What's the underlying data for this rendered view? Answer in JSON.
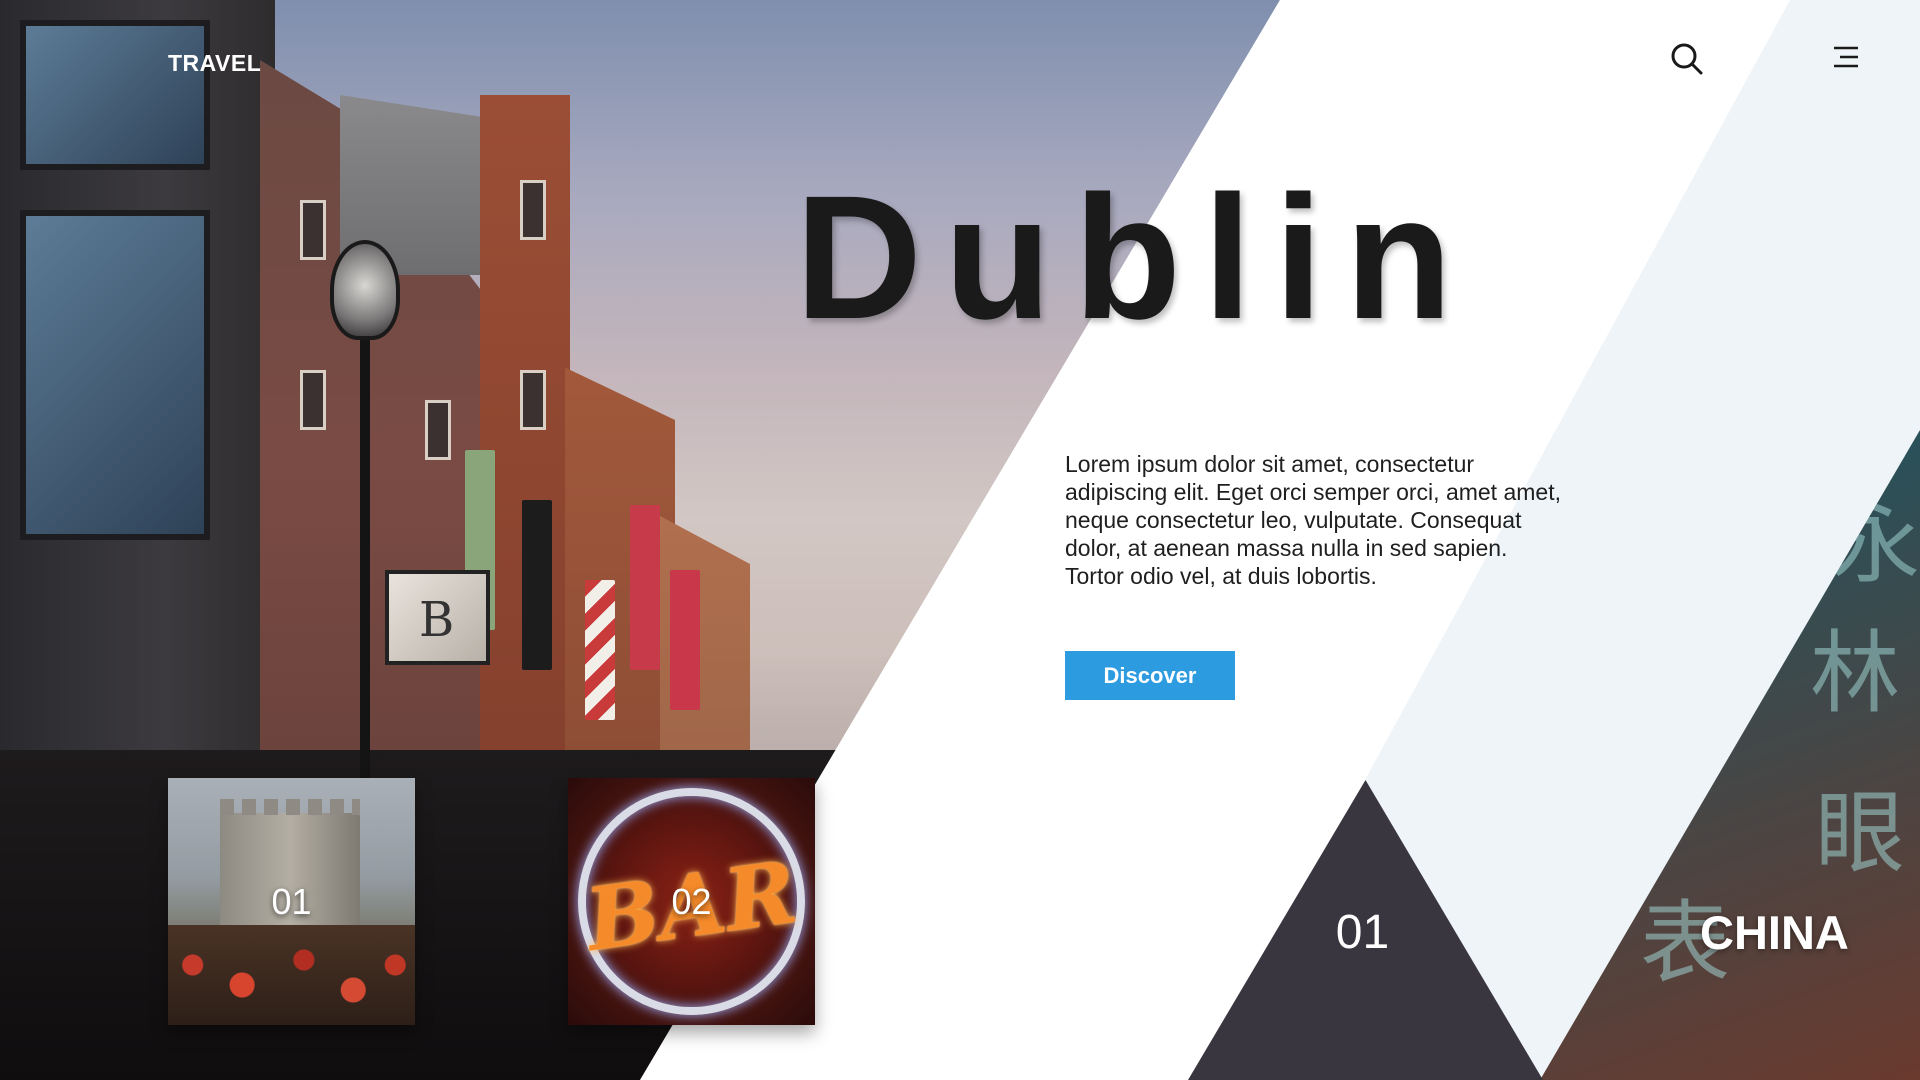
{
  "header": {
    "brand": "TRAVEL",
    "search_icon": "search-icon",
    "menu_icon": "menu-icon"
  },
  "hero": {
    "title": "Dublin",
    "description": "Lorem ipsum dolor sit amet, consectetur adipiscing elit. Eget orci semper orci, amet amet, neque consectetur leo, vulputate. Consequat dolor, at aenean massa nulla in sed sapien. Tortor odio vel, at duis lobortis.",
    "cta_label": "Discover"
  },
  "thumbnails": [
    {
      "number": "01"
    },
    {
      "number": "02"
    }
  ],
  "slider": {
    "current": "01",
    "next_destination": "CHINA"
  },
  "colors": {
    "accent": "#2d9be0",
    "dark_triangle": "#3a3640",
    "light_panel": "#eef4f8",
    "title": "#1a1a1a"
  }
}
